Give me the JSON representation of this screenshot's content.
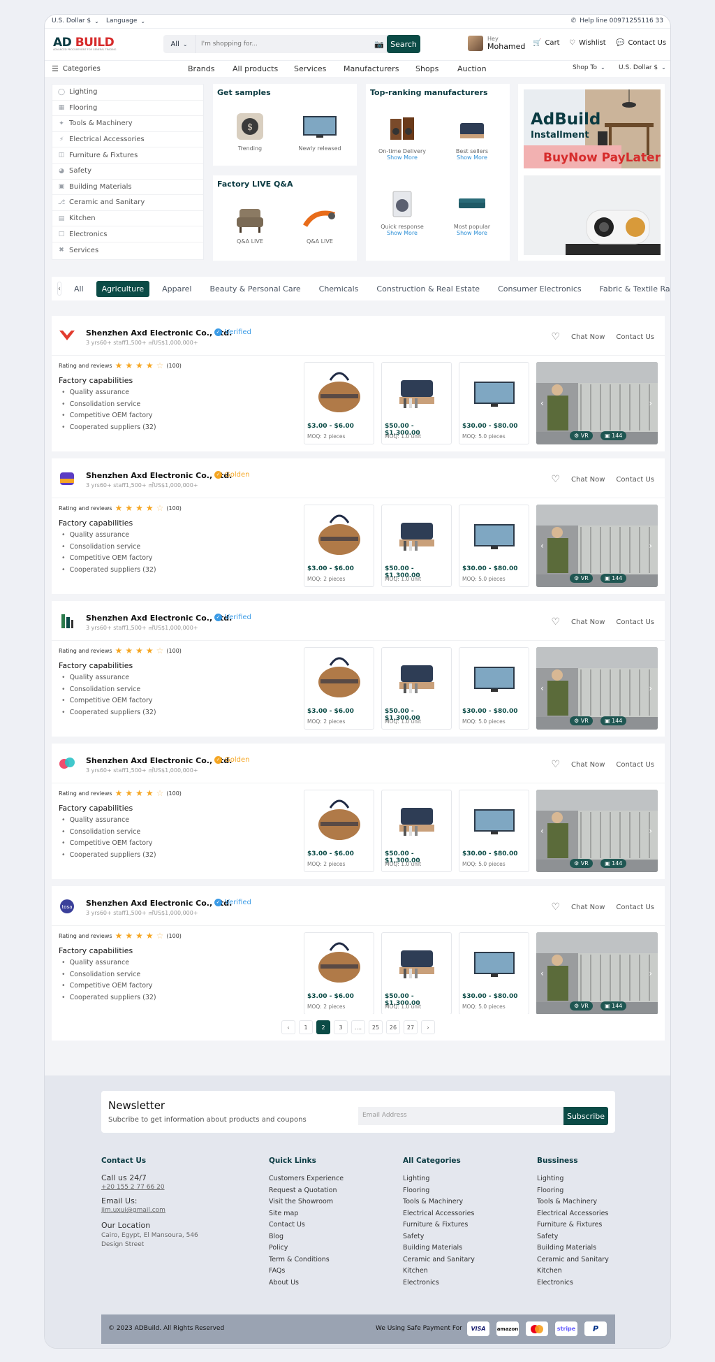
{
  "topbar": {
    "currency": "U.S. Dollar $",
    "language": "Language",
    "helpline": "Help line 00971255116 33"
  },
  "header": {
    "logo_text_a": "AD",
    "logo_text_b": "BUILD",
    "logo_tagline": "ADVANCED PROCUREMENT FOR GENERAL TRADING",
    "search_category": "All",
    "search_placeholder": "I'm shopping for...",
    "search_button": "Search",
    "greeting": "Hey",
    "user_name": "Mohamed",
    "cart": "Cart",
    "wishlist": "Wishlist",
    "contact": "Contact Us"
  },
  "nav": {
    "categories": "Categories",
    "items": [
      "Brands",
      "All products",
      "Services",
      "Manufacturers",
      "Shops",
      "Auction"
    ],
    "ship_to": "Shop To",
    "currency": "U.S. Dollar $"
  },
  "sidebar": {
    "items": [
      "Lighting",
      "Flooring",
      "Tools & Machinery",
      "Electrical Accessories",
      "Furniture & Fixtures",
      "Safety",
      "Building Materials",
      "Ceramic and Sanitary",
      "Kitchen",
      "Electronics",
      "Services"
    ]
  },
  "samples": {
    "title": "Get samples",
    "items": [
      "Trending",
      "Newly released"
    ]
  },
  "live": {
    "title": "Factory LIVE Q&A",
    "items": [
      "Q&A LIVE",
      "Q&A LIVE"
    ]
  },
  "ranking": {
    "title": "Top-ranking manufacturers",
    "items": [
      "On-time Delivery",
      "Best sellers",
      "Quick response",
      "Most popular"
    ],
    "show_more": "Show More"
  },
  "promo": {
    "brand": "AdBuild",
    "line2": "Installment",
    "line3": "BuyNow PayLater"
  },
  "chips": [
    "All",
    "Agriculture",
    "Apparel",
    "Beauty & Personal Care",
    "Chemicals",
    "Construction & Real Estate",
    "Consumer Electronics",
    "Fabric & Textile Raw Material"
  ],
  "suppliers": [
    {
      "name": "Shenzhen Axd Electronic Co., Ltd.",
      "badge": "Verified",
      "meta": "3 yrs60+ staff1,500+ ㎡US$1,000,000+"
    },
    {
      "name": "Shenzhen Axd Electronic Co., Ltd.",
      "badge": "Golden",
      "meta": "3 yrs60+ staff1,500+ ㎡US$1,000,000+"
    },
    {
      "name": "Shenzhen Axd Electronic Co., Ltd.",
      "badge": "Verified",
      "meta": "3 yrs60+ staff1,500+ ㎡US$1,000,000+"
    },
    {
      "name": "Shenzhen Axd Electronic Co., Ltd.",
      "badge": "Golden",
      "meta": "3 yrs60+ staff1,500+ ㎡US$1,000,000+"
    },
    {
      "name": "Shenzhen Axd Electronic Co., Ltd.",
      "badge": "Verified",
      "meta": "3 yrs60+ staff1,500+ ㎡US$1,000,000+"
    }
  ],
  "supplier_common": {
    "chat": "Chat Now",
    "contact": "Contact Us",
    "rating_label": "Rating and reviews",
    "rating_count": "(100)",
    "rating_value": 4,
    "fc_title": "Factory capabilities",
    "capabilities": [
      "Quality assurance",
      "Consolidation service",
      "Competitive OEM factory",
      "Cooperated suppliers (32)"
    ],
    "products": [
      {
        "price": "$3.00 - $6.00",
        "moq": "MOQ: 2 pieces"
      },
      {
        "price": "$50.00 - $1,300.00",
        "moq": "MOQ: 1.0 unit"
      },
      {
        "price": "$30.00 - $80.00",
        "moq": "MOQ: 5.0 pieces"
      }
    ],
    "vr": "VR",
    "photos": "144"
  },
  "pager": {
    "pages": [
      "1",
      "2",
      "3",
      "....",
      "25",
      "26",
      "27"
    ],
    "active": "2"
  },
  "newsletter": {
    "title": "Newsletter",
    "subtitle": "Subcribe to get information about products and coupons",
    "placeholder": "Email Address",
    "button": "Subscribe"
  },
  "footer": {
    "contact": {
      "title": "Contact Us",
      "call_label": "Call us 24/7",
      "phone": "+20 155 2 77 66 20",
      "email_label": "Email Us:",
      "email": "jim.uxui@gmail.com",
      "loc_label": "Our Location",
      "address": "Cairo, Egypt, El Mansoura, 546 Design Street"
    },
    "quick": {
      "title": "Quick Links",
      "links": [
        "Customers Experience",
        "Request a Quotation",
        "Visit the Showroom",
        "Site map",
        "Contact Us",
        "Blog",
        "Policy",
        "Term & Conditions",
        "FAQs",
        "About Us"
      ]
    },
    "cats": {
      "title": "All Categories",
      "links": [
        "Lighting",
        "Flooring",
        "Tools & Machinery",
        "Electrical Accessories",
        "Furniture & Fixtures",
        "Safety",
        "Building Materials",
        "Ceramic and Sanitary",
        "Kitchen",
        "Electronics"
      ]
    },
    "biz": {
      "title": "Bussiness",
      "links": [
        "Lighting",
        "Flooring",
        "Tools & Machinery",
        "Electrical Accessories",
        "Furniture & Fixtures",
        "Safety",
        "Building Materials",
        "Ceramic and Sanitary",
        "Kitchen",
        "Electronics"
      ]
    },
    "copyright": "© 2023 ADBuild. All Rights Reserved",
    "payment_label": "We Using Safe Payment For",
    "payments": [
      "VISA",
      "amazon",
      "",
      "stripe",
      "P"
    ]
  },
  "colors": {
    "primary": "#0b4b46",
    "verified": "#3b9be6",
    "golden": "#f5a623",
    "star": "#f5a623"
  }
}
